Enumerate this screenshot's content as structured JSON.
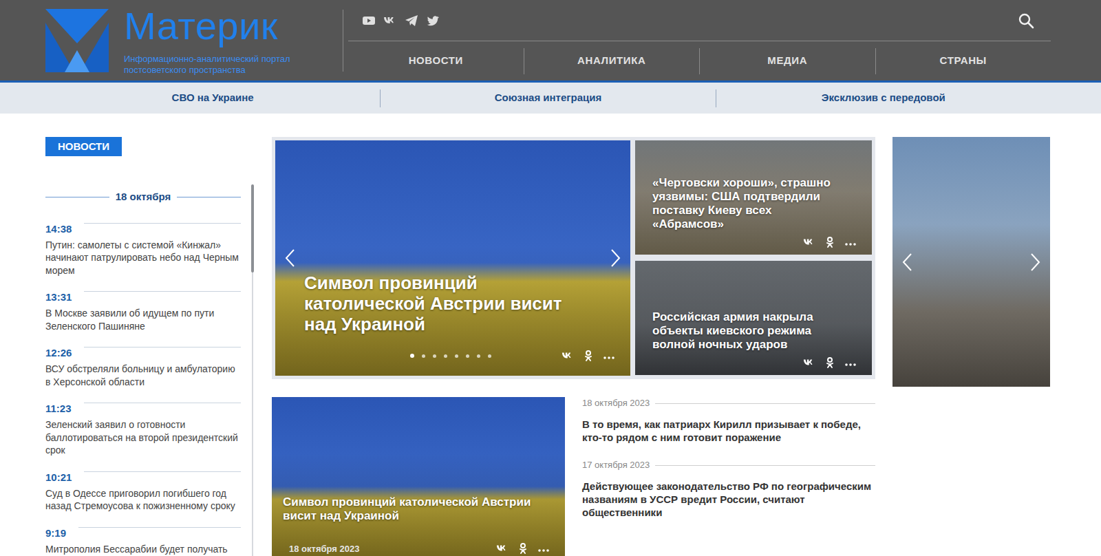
{
  "logo": {
    "title": "Материк",
    "subtitle": "Информационно-аналитический портал постсоветского пространства"
  },
  "nav": [
    "НОВОСТИ",
    "АНАЛИТИКА",
    "МЕДИА",
    "СТРАНЫ"
  ],
  "subnav": [
    "СВО на Украине",
    "Союзная интеграция",
    "Эксклюзив с передовой"
  ],
  "news": {
    "badge": "НОВОСТИ",
    "date": "18 октября",
    "items": [
      {
        "time": "14:38",
        "title": "Путин: самолеты с системой «Кинжал» начинают патрулировать небо над Черным морем"
      },
      {
        "time": "13:31",
        "title": "В Москве заявили об идущем по пути Зеленского Пашиняне"
      },
      {
        "time": "12:26",
        "title": "ВСУ обстреляли больницу и амбулаторию в Херсонской области"
      },
      {
        "time": "11:23",
        "title": "Зеленский заявил о готовности баллотироваться на второй президентский срок"
      },
      {
        "time": "10:21",
        "title": "Суд в Одессе приговорил погибшего год назад Стремоусова к пожизненному сроку"
      },
      {
        "time": "9:19",
        "title": "Митрополия Бессарабии будет получать"
      }
    ]
  },
  "slider": {
    "title": "Символ провинций католической Австрии висит над Украиной",
    "dots": [
      {
        "selected": true
      },
      {
        "selected": false
      },
      {
        "selected": false
      },
      {
        "selected": false
      },
      {
        "selected": false
      },
      {
        "selected": false
      },
      {
        "selected": false
      },
      {
        "selected": false
      }
    ]
  },
  "side_stories": [
    {
      "title": "«Чертовски хороши», страшно уязвимы: США подтвердили поставку Киеву всех «Абрамсов»"
    },
    {
      "title": "Российская армия накрыла объекты киевского режима волной ночных ударов"
    }
  ],
  "feature": {
    "title": "Символ провинций католической Австрии висит над Украиной",
    "date": "18 октября 2023"
  },
  "articles": [
    {
      "date": "18 октября 2023",
      "title": "В то время, как патриарх Кирилл призывает к победе, кто-то рядом с ним готовит поражение"
    },
    {
      "date": "17 октября 2023",
      "title": "Действующее законодательство РФ по географическим названиям в УССР вредит России, считают общественники"
    }
  ]
}
